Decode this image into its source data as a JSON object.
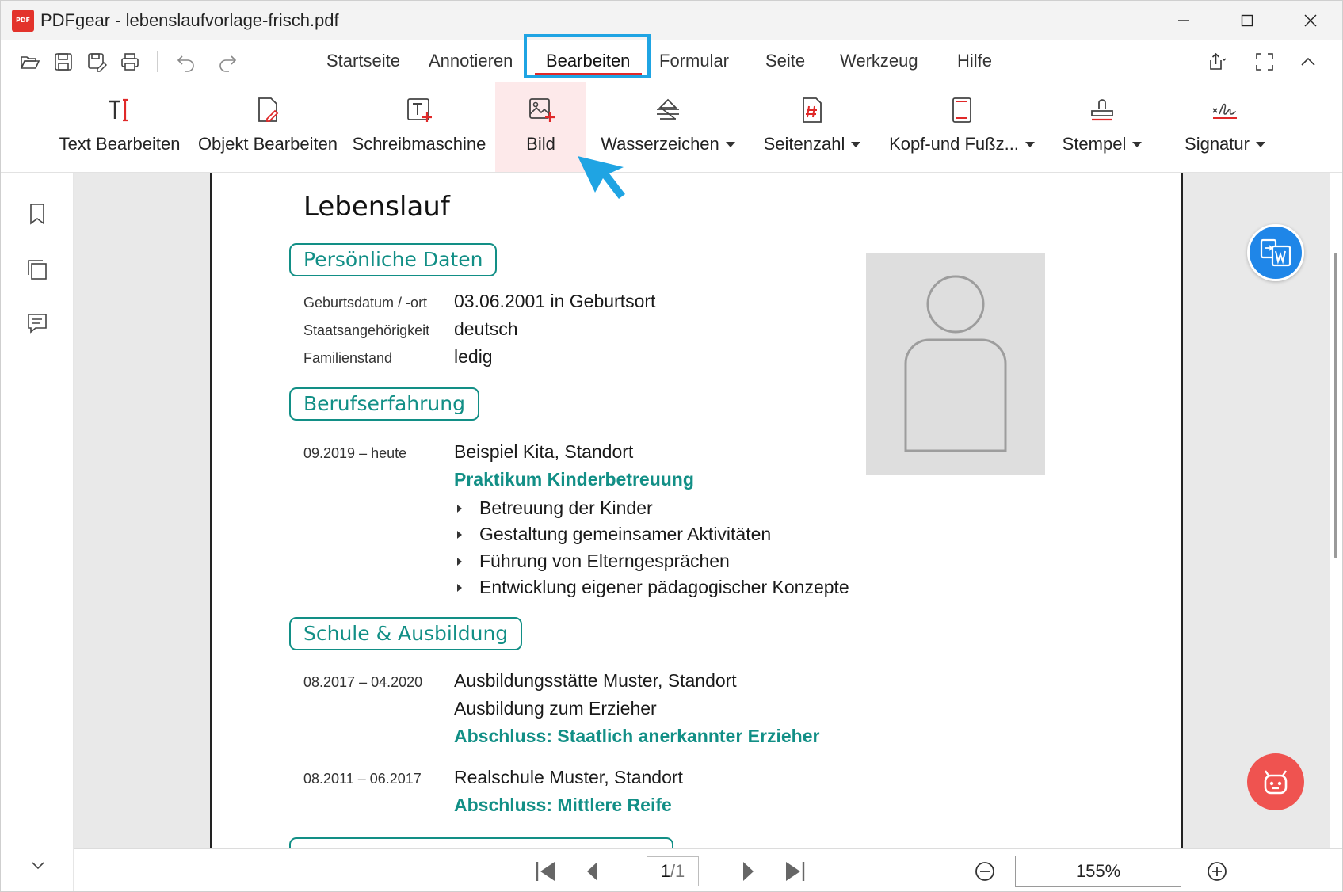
{
  "window": {
    "logo_text": "PDF",
    "title": "PDFgear - lebenslaufvorlage-frisch.pdf"
  },
  "menu": {
    "tabs": [
      "Startseite",
      "Annotieren",
      "Bearbeiten",
      "Formular",
      "Seite",
      "Werkzeug",
      "Hilfe"
    ],
    "active_tab": "Bearbeiten"
  },
  "ribbon": {
    "items": [
      {
        "label": "Text Bearbeiten",
        "icon": "text-edit-icon"
      },
      {
        "label": "Objekt Bearbeiten",
        "icon": "object-edit-icon"
      },
      {
        "label": "Schreibmaschine",
        "icon": "typewriter-icon"
      },
      {
        "label": "Bild",
        "icon": "image-add-icon"
      },
      {
        "label": "Wasserzeichen",
        "icon": "watermark-icon"
      },
      {
        "label": "Seitenzahl",
        "icon": "page-number-icon"
      },
      {
        "label": "Kopf-und Fußz...",
        "icon": "header-footer-icon"
      },
      {
        "label": "Stempel",
        "icon": "stamp-icon"
      },
      {
        "label": "Signatur",
        "icon": "signature-icon"
      }
    ]
  },
  "document": {
    "title": "Lebenslauf",
    "personal": {
      "heading": "Persönliche Daten",
      "rows": [
        {
          "label": "Geburtsdatum / -ort",
          "value": "03.06.2001 in Geburtsort"
        },
        {
          "label": "Staatsangehörigkeit",
          "value": "deutsch"
        },
        {
          "label": "Familienstand",
          "value": "ledig"
        }
      ]
    },
    "experience": {
      "heading": "Berufserfahrung",
      "period": "09.2019 – heute",
      "place": "Beispiel Kita, Standort",
      "role": "Praktikum Kinderbetreuung",
      "bullets": [
        "Betreuung der Kinder",
        "Gestaltung gemeinsamer Aktivitäten",
        "Führung von Elterngesprächen",
        "Entwicklung eigener pädagogischer Konzepte"
      ]
    },
    "education": {
      "heading": "Schule & Ausbildung",
      "entries": [
        {
          "period": "08.2017 – 04.2020",
          "place": "Ausbildungsstätte Muster, Standort",
          "detail": "Ausbildung zum Erzieher",
          "result": "Abschluss: Staatlich anerkannter Erzieher"
        },
        {
          "period": "08.2011 – 06.2017",
          "place": "Realschule Muster, Standort",
          "result": "Abschluss: Mittlere Reife"
        }
      ]
    }
  },
  "navigation": {
    "current_page": "1",
    "total_pages": "/1",
    "zoom": "155%"
  },
  "colors": {
    "accent_teal": "#128f86",
    "highlight_blue": "#1fa4e3",
    "active_underline": "#e02929",
    "word_button": "#1f86e8",
    "ai_button": "#ef5350"
  }
}
